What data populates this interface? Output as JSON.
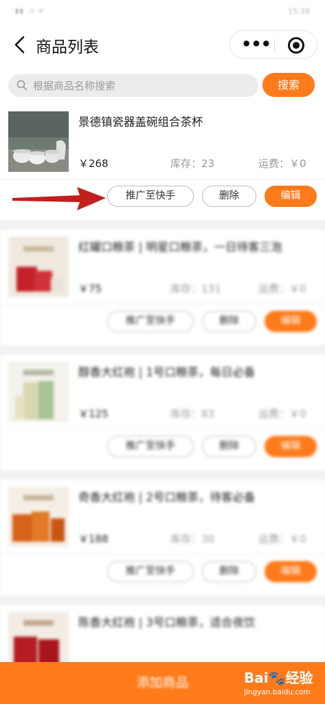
{
  "status": {
    "left": "▮▮ .ıl ᯤ",
    "time": "15:39"
  },
  "nav": {
    "title": "商品列表",
    "more_icon": "more-dots-icon",
    "target_icon": "target-icon"
  },
  "search": {
    "placeholder": "根据商品名称搜索",
    "button": "搜索"
  },
  "products": [
    {
      "name": "景德镇瓷器盖碗组合茶杯",
      "price": "￥268",
      "stock": "库存：23",
      "shipping": "运费：￥0",
      "promote": "推广至快手",
      "delete": "删除",
      "edit": "编辑"
    },
    {
      "name": "红罐口粮茶 | 明星口粮茶，一日待客三泡",
      "price": "￥75",
      "stock": "库存：131",
      "shipping": "运费：￥0",
      "promote": "推广至快手",
      "delete": "删除",
      "edit": "编辑"
    },
    {
      "name": "醇香大红袍 | 1号口粮茶，每日必备",
      "price": "￥125",
      "stock": "库存：83",
      "shipping": "运费：￥0",
      "promote": "推广至快手",
      "delete": "删除",
      "edit": "编辑"
    },
    {
      "name": "奇香大红袍 | 2号口粮茶，待客必备",
      "price": "￥188",
      "stock": "库存：30",
      "shipping": "运费：￥0",
      "promote": "推广至快手",
      "delete": "删除",
      "edit": "编辑"
    },
    {
      "name": "陈香大红袍 | 3号口粮茶，适合夜饮"
    }
  ],
  "footer": {
    "add": "添加商品"
  },
  "watermark": {
    "logo": "Bai🐾经验",
    "url": "jingyan.baidu.com"
  },
  "colors": {
    "accent": "#ff7a1a",
    "arrow": "#c0201e"
  }
}
